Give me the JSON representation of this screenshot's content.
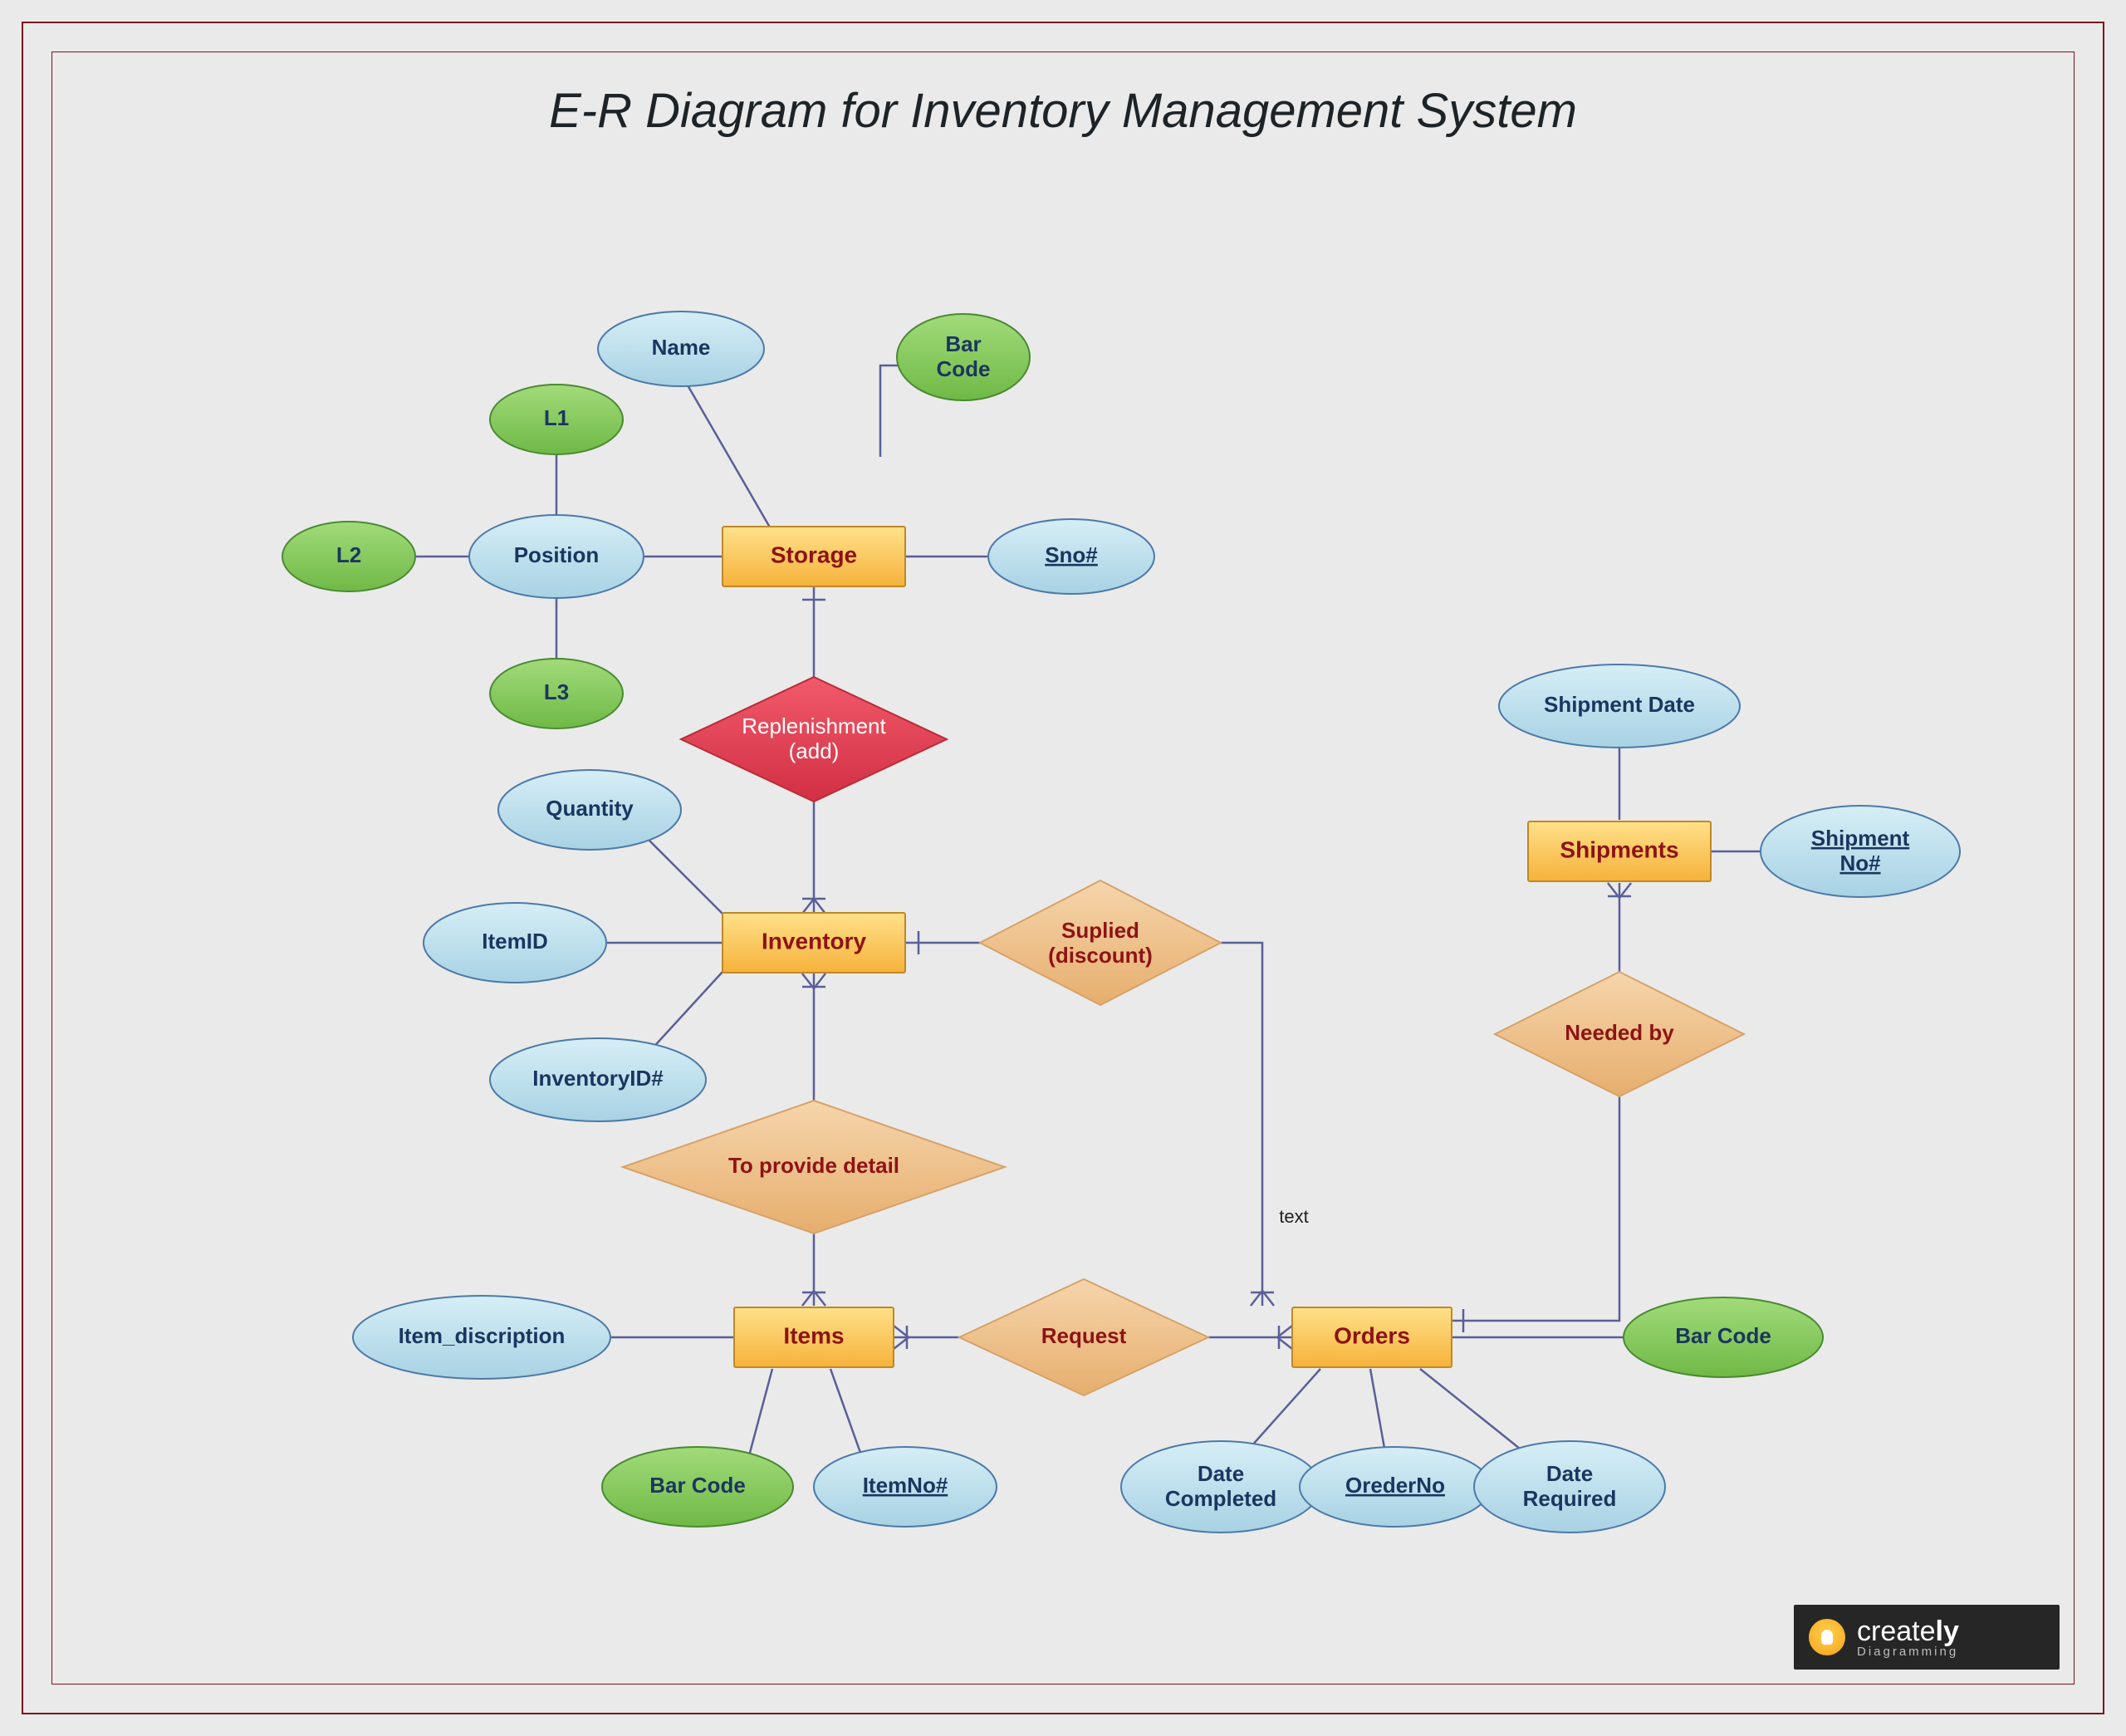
{
  "title": "E-R Diagram for Inventory Management System",
  "entities": {
    "storage": "Storage",
    "inventory": "Inventory",
    "items": "Items",
    "orders": "Orders",
    "shipments": "Shipments"
  },
  "relationships": {
    "replenishment": {
      "label_line1": "Replenishment",
      "label_line2": "(add)"
    },
    "supplied": {
      "label_line1": "Suplied",
      "label_line2": "(discount)"
    },
    "to_provide_detail": "To provide detail",
    "request": "Request",
    "needed_by": "Needed by"
  },
  "link_labels": {
    "supplied_orders": "text"
  },
  "attributes": {
    "storage": {
      "name": "Name",
      "barcode": "Bar Code",
      "sno": "Sno#",
      "position": "Position",
      "position_children": {
        "l1": "L1",
        "l2": "L2",
        "l3": "L3"
      }
    },
    "inventory": {
      "quantity": "Quantity",
      "itemid": "ItemID",
      "inventoryid": "InventoryID#"
    },
    "items": {
      "item_description": "Item_discription",
      "itemno": "ItemNo#",
      "barcode": "Bar Code"
    },
    "orders": {
      "date_completed_l1": "Date",
      "date_completed_l2": "Completed",
      "orderno": "OrederNo",
      "date_required_l1": "Date",
      "date_required_l2": "Required",
      "barcode": "Bar Code"
    },
    "shipments": {
      "shipment_date": "Shipment Date",
      "shipment_no_l1": "Shipment",
      "shipment_no_l2": "No#"
    }
  },
  "logo": {
    "brand_plain": "create",
    "brand_bold": "ly",
    "sub": "Diagramming"
  }
}
